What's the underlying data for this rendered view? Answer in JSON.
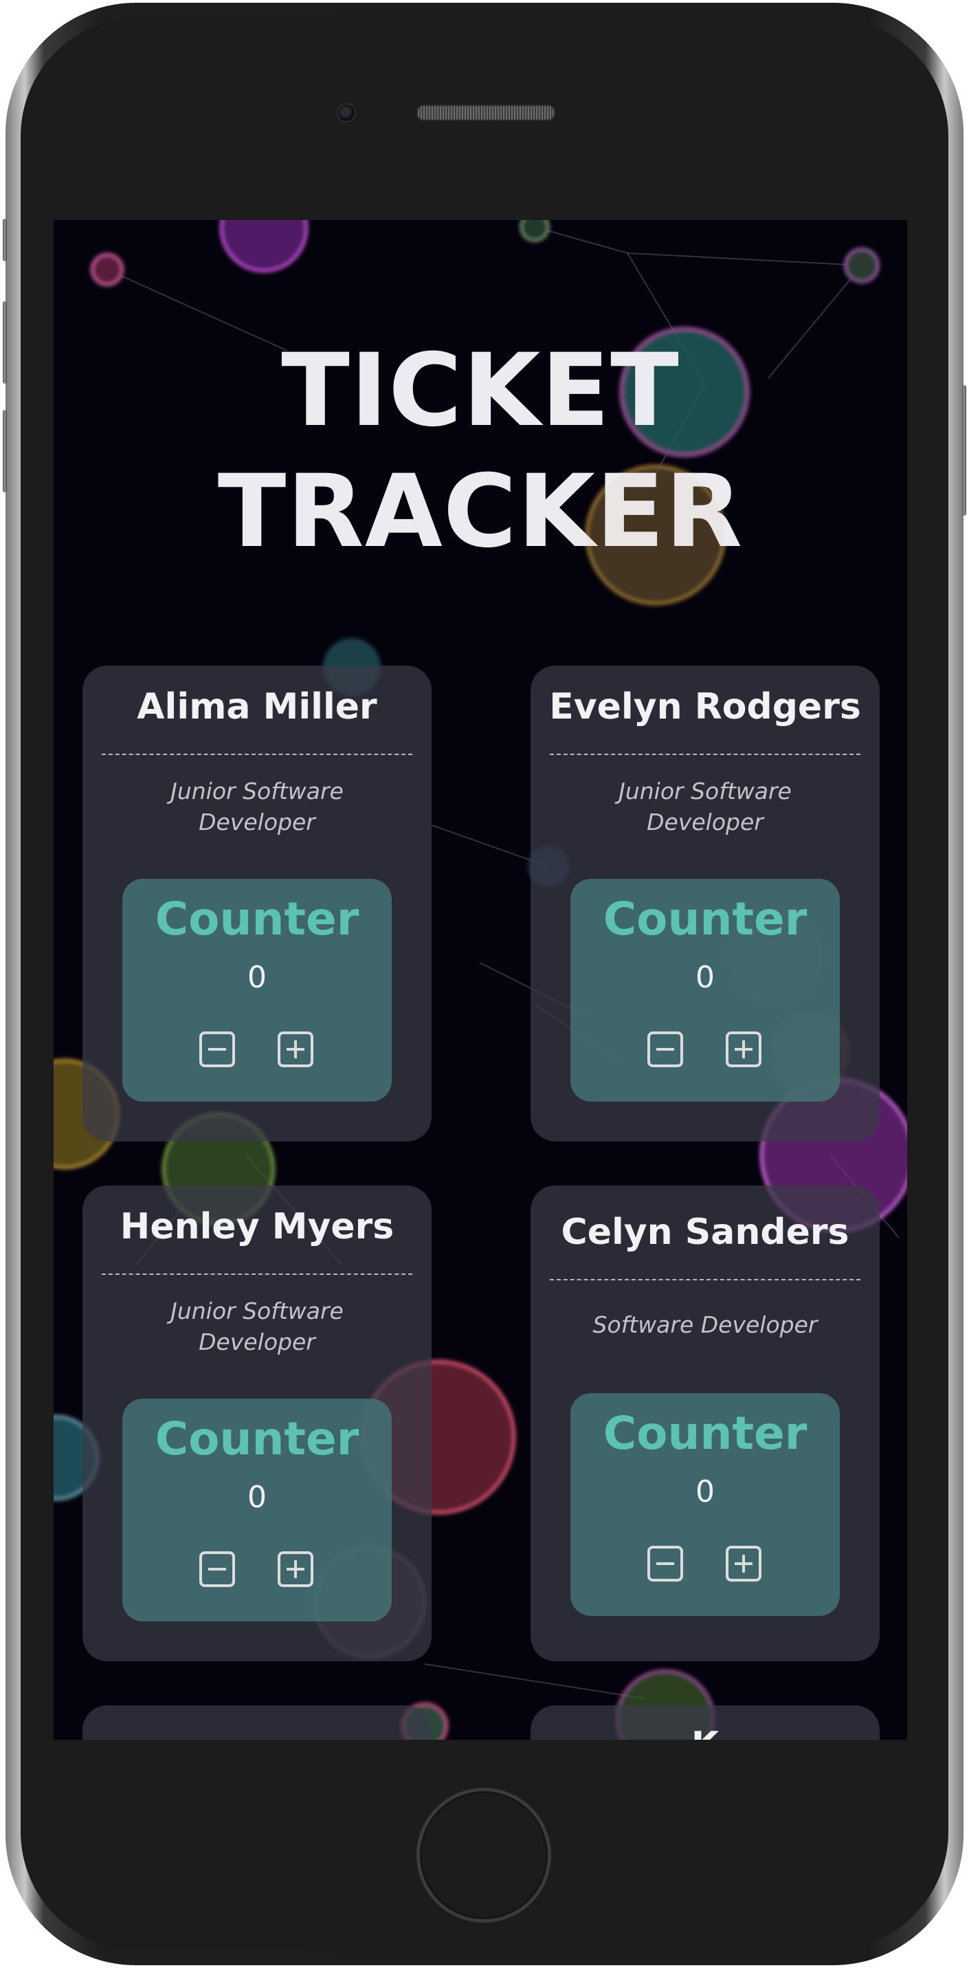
{
  "app": {
    "title_line1": "TICKET",
    "title_line2": "TRACKER"
  },
  "cards": [
    {
      "name": "Alima Miller",
      "role": "Junior Software Developer",
      "counter_label": "Counter",
      "count": "0"
    },
    {
      "name": "Evelyn Rodgers",
      "role": "Junior Software Developer",
      "counter_label": "Counter",
      "count": "0"
    },
    {
      "name": "Henley Myers",
      "role": "Junior Software Developer",
      "counter_label": "Counter",
      "count": "0"
    },
    {
      "name": "Celyn Sanders",
      "role": "Software Developer",
      "counter_label": "Counter",
      "count": "0"
    },
    {
      "name": "",
      "role": "",
      "counter_label": "",
      "count": ""
    },
    {
      "name": "K",
      "role": "",
      "counter_label": "",
      "count": ""
    }
  ],
  "icons": {
    "decrement": "minus-square-icon",
    "increment": "plus-square-icon"
  },
  "colors": {
    "background": "#04020d",
    "card": "#3a3a48",
    "counter_panel": "#447576",
    "accent": "#5cc3b2",
    "text": "#f2f2f5"
  }
}
